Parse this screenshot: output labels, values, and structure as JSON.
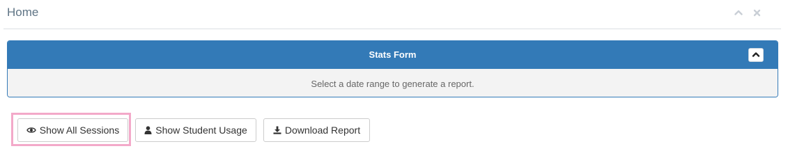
{
  "header": {
    "title": "Home",
    "collapse_icon": "chevron-up-icon",
    "close_icon": "close-icon"
  },
  "panel": {
    "title": "Stats Form",
    "collapse_icon": "chevron-up-icon",
    "hint": "Select a date range to generate a report.",
    "accent_color": "#337ab7"
  },
  "actions": {
    "show_all_sessions": {
      "label": "Show All Sessions",
      "icon": "eye-icon",
      "highlighted": true
    },
    "show_student_usage": {
      "label": "Show Student Usage",
      "icon": "user-icon"
    },
    "download_report": {
      "label": "Download Report",
      "icon": "download-icon"
    }
  },
  "highlight_color": "#f3a9c9"
}
